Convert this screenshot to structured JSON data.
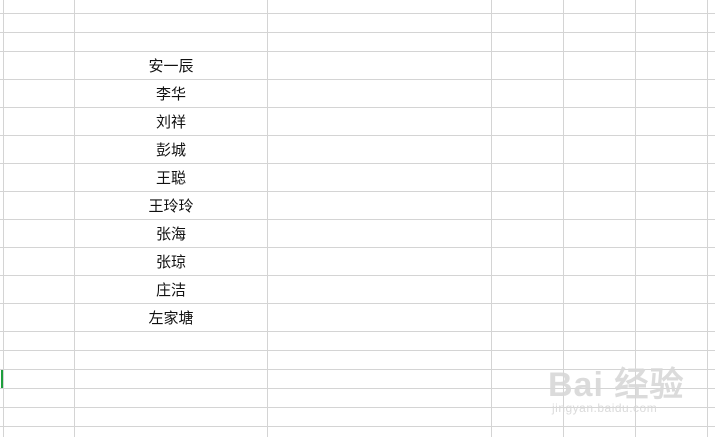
{
  "sheet": {
    "names": [
      "安一辰",
      "李华",
      "刘祥",
      "彭城",
      "王聪",
      "王玲玲",
      "张海",
      "张琼",
      "庄洁",
      "左家塘"
    ]
  },
  "watermark": {
    "logo": "Bai 经验",
    "url": "jingyan.baidu.com"
  },
  "colors": {
    "grid": "#d4d4d4",
    "active_marker": "#1e9f3d"
  }
}
